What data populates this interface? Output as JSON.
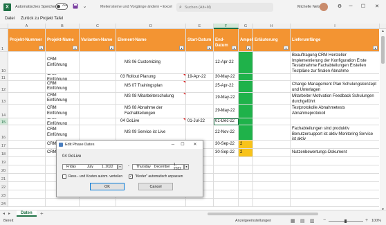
{
  "titlebar": {
    "app_icon": "X",
    "autosave_label": "Automatisches Speichern",
    "autosave_state": "Aus",
    "save_icon": "save-icon",
    "doc_title": "Meilensteine und Vorgänge ändern  •  Excel",
    "search_placeholder": "Suchen (Alt+M)",
    "user_name": "Michelle Nelson",
    "minimize": "─",
    "maximize": "☐",
    "close": "✕"
  },
  "menu": {
    "items": [
      "Datei",
      "Zurück zu Projekt Tafel"
    ]
  },
  "columns": [
    "A",
    "B",
    "C",
    "D",
    "E",
    "F",
    "G",
    "H",
    "I"
  ],
  "headers": {
    "projekt_nummer": "Projekt-Nummer",
    "projekt_name": "Projekt-Name",
    "varianten_name": "Varianten-Name",
    "element_name": "Element-Name",
    "start_datum": "Start-Datum",
    "end_datum": "End-Datum",
    "ampel": "Ampel",
    "erlaeuterung": "Erläuterung",
    "lieferumfaenge": "Lieferumfänge",
    "filter": "▾"
  },
  "rows": [
    {
      "num": "10",
      "projekt": "CRM Einführung",
      "element": "MS 06 Customizing",
      "start": "",
      "end": "12-Apr-22",
      "ampel": "green",
      "ampel_text": "",
      "liefer": "Beauftragung CRM Hersteller Implementierung der Konfiguration Erste Testabnahme Fachabteilungen Erstellen Testpläne zur finalen Abnahme"
    },
    {
      "num": "11",
      "projekt": "CRM Einführung",
      "element": "03 Rollout Planung",
      "start": "19-Apr-22",
      "end": "30-May-22",
      "ampel": "green",
      "ampel_text": "",
      "liefer": ""
    },
    {
      "num": "12",
      "projekt": "CRM Einführung",
      "element": "MS 07 Trainingsplan",
      "start": "",
      "end": "25-Apr-22",
      "ampel": "green",
      "ampel_text": "",
      "liefer": "Change Management Plan Schulungskonzept und Unterlagen"
    },
    {
      "num": "13",
      "projekt": "CRM Einführung",
      "element": "MS 08 Mitarbeiterschulung",
      "start": "",
      "end": "19-May-22",
      "ampel": "green",
      "ampel_text": "",
      "liefer": "Mitarbeiter Motivation Feedback Schulungen durchgeführt"
    },
    {
      "num": "14",
      "projekt": "CRM Einführung",
      "element": "MS 08 Abnahme der Fachabteilungen",
      "start": "",
      "end": "29-May-22",
      "ampel": "green",
      "ampel_text": "",
      "liefer": "Testprotokolle Abnahmetests Abnahmeprotokoll"
    },
    {
      "num": "15",
      "projekt": "CRM Einführung",
      "element": "04 GoLive",
      "start": "01-Jul-22",
      "end": "01-Dec-22",
      "ampel": "green",
      "ampel_text": "",
      "liefer": ""
    },
    {
      "num": "16",
      "projekt": "CRM Einführung",
      "element": "MS 09 Service ist Live",
      "start": "",
      "end": "22-Nov-22",
      "ampel": "green",
      "ampel_text": "",
      "liefer": "Fachabteilungen sind produktiv Benutzersupport ist aktiv Monitoring Service ist aktiv"
    },
    {
      "num": "17",
      "projekt": "CRM",
      "element": "",
      "start": "",
      "end": "30-Sep-22",
      "ampel": "yellow",
      "ampel_text": "2",
      "liefer": ""
    },
    {
      "num": "18",
      "projekt": "CRM",
      "element": "",
      "start": "",
      "end": "30-Sep-22",
      "ampel": "yellow",
      "ampel_text": "2",
      "liefer": "Nutzenbewertungs-Dokument"
    },
    {
      "num": "19",
      "projekt": "",
      "element": "",
      "start": "",
      "end": "",
      "ampel": "none",
      "ampel_text": "",
      "liefer": ""
    },
    {
      "num": "20",
      "projekt": "",
      "element": "",
      "start": "",
      "end": "",
      "ampel": "none",
      "ampel_text": "",
      "liefer": ""
    },
    {
      "num": "21",
      "projekt": "",
      "element": "",
      "start": "",
      "end": "",
      "ampel": "none",
      "ampel_text": "",
      "liefer": ""
    },
    {
      "num": "22",
      "projekt": "",
      "element": "",
      "start": "",
      "end": "",
      "ampel": "none",
      "ampel_text": "",
      "liefer": ""
    },
    {
      "num": "23",
      "projekt": "",
      "element": "",
      "start": "",
      "end": "",
      "ampel": "none",
      "ampel_text": "",
      "liefer": ""
    },
    {
      "num": "24",
      "projekt": "",
      "element": "",
      "start": "",
      "end": "",
      "ampel": "none",
      "ampel_text": "",
      "liefer": ""
    }
  ],
  "dialog": {
    "title": "Edit Phase Dates",
    "heading": "04 GoLive",
    "start_day": "Friday",
    "start_month": "July",
    "start_date": "1, 2022",
    "end_day": "Thursday",
    "end_month": "December",
    "end_date": "1, 2022",
    "separator": "-",
    "checkbox1_label": "Ress.- und Kosten autom. verteilen",
    "checkbox1_checked": false,
    "checkbox2_label": "\"Kinder\" automatisch anpassen",
    "checkbox2_checked": true,
    "ok_label": "OK",
    "cancel_label": "Cancel",
    "minimize": "─",
    "maximize": "☐",
    "close": "✕",
    "dropdown": "▾"
  },
  "sheet": {
    "tab": "Daten",
    "add": "+"
  },
  "status": {
    "ready": "Bereit",
    "display_settings": "Anzeigeeinstellungen",
    "zoom": "100%"
  },
  "colors": {
    "header_orange": "#f39432",
    "ampel_green": "#1fb24a",
    "ampel_yellow": "#f8c31a",
    "excel_green": "#1e7145"
  }
}
